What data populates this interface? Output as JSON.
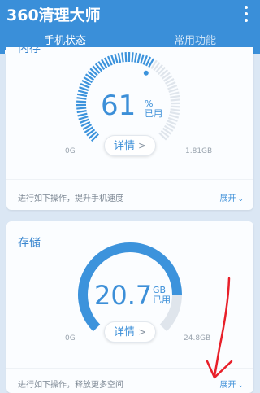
{
  "app": {
    "title": "360清理大师"
  },
  "tabs": [
    {
      "label": "手机状态",
      "active": true
    },
    {
      "label": "常用功能",
      "active": false
    }
  ],
  "memory_card": {
    "title": "内存",
    "value": "61",
    "unit": "%",
    "unit_sub": "已用",
    "used_fraction": 0.61,
    "detail_label": "详情",
    "min_label": "0G",
    "max_label": "1.81GB",
    "footer_text": "进行如下操作，提升手机速度",
    "expand_label": "展开"
  },
  "storage_card": {
    "title": "存储",
    "value": "20.7",
    "unit": "GB",
    "unit_sub": "已用",
    "used_fraction": 0.835,
    "detail_label": "详情",
    "min_label": "0G",
    "max_label": "24.8GB",
    "footer_text": "进行如下操作，释放更多空间",
    "expand_label": "展开"
  },
  "colors": {
    "header": "#3a8fd9",
    "accent": "#3c8fd8",
    "annotation": "#e8202a"
  }
}
